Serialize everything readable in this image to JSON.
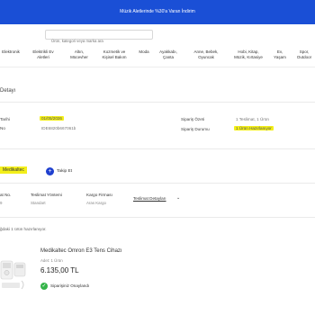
{
  "promo": {
    "text": "Müzik Aletlerinde %30'a Varan İndirim"
  },
  "search": {
    "placeholder": "Ürün, kategori veya marka ara"
  },
  "categories": [
    "Elektronik",
    "Elektrikli Ev\nAletleri",
    "Altın,\nMücevher",
    "Kozmetik ve\nKişisel Bakım",
    "Moda",
    "Ayakkabı,\nÇanta",
    "Anne, Bebek,\nOyuncak",
    "Hobi, Kitap,\nMüzik, Kırtasiye",
    "Ev,\nYaşam",
    "Spor,\nOutdoor"
  ],
  "order": {
    "section_title": "Detayı",
    "date_label": "Tarihi",
    "date_value": "01/05/2026",
    "no_label": "No",
    "no_value": "IDE6820b667061b",
    "summary_label": "Sipariş Özeti",
    "summary_value": "1 Teslimat, 1 Ürün",
    "status_label": "Sipariş Durumu",
    "status_value": "1 Ürün Hazırlanıyor"
  },
  "seller": {
    "name": "Medikaltec",
    "follow_label": "Takip Et"
  },
  "delivery": {
    "headers": [
      "at No.",
      "Teslimat Yöntemi",
      "Kargo Firması"
    ],
    "values": [
      "9",
      "Standart",
      "Aras Kargo"
    ],
    "track_label": "Teslimat Detayları",
    "ready_note": "ğdaki 1 ürün hazırlanıyor."
  },
  "product": {
    "name": "Medikaltec Omron E3 Tens Cihazı",
    "qty_label": "Adet:",
    "qty_value": "1 Ürün",
    "price": "6.135,00 TL",
    "status": "Siparişiniz Onaylandı"
  },
  "colors": {
    "promo_bg": "#1a4fd6",
    "highlight": "#f3ef1a",
    "follow_button": "#1e3fcf",
    "status_ok": "#34b449"
  },
  "icons": {
    "follow": "plus-icon",
    "status": "check-icon",
    "track": "chevron-down-icon"
  }
}
